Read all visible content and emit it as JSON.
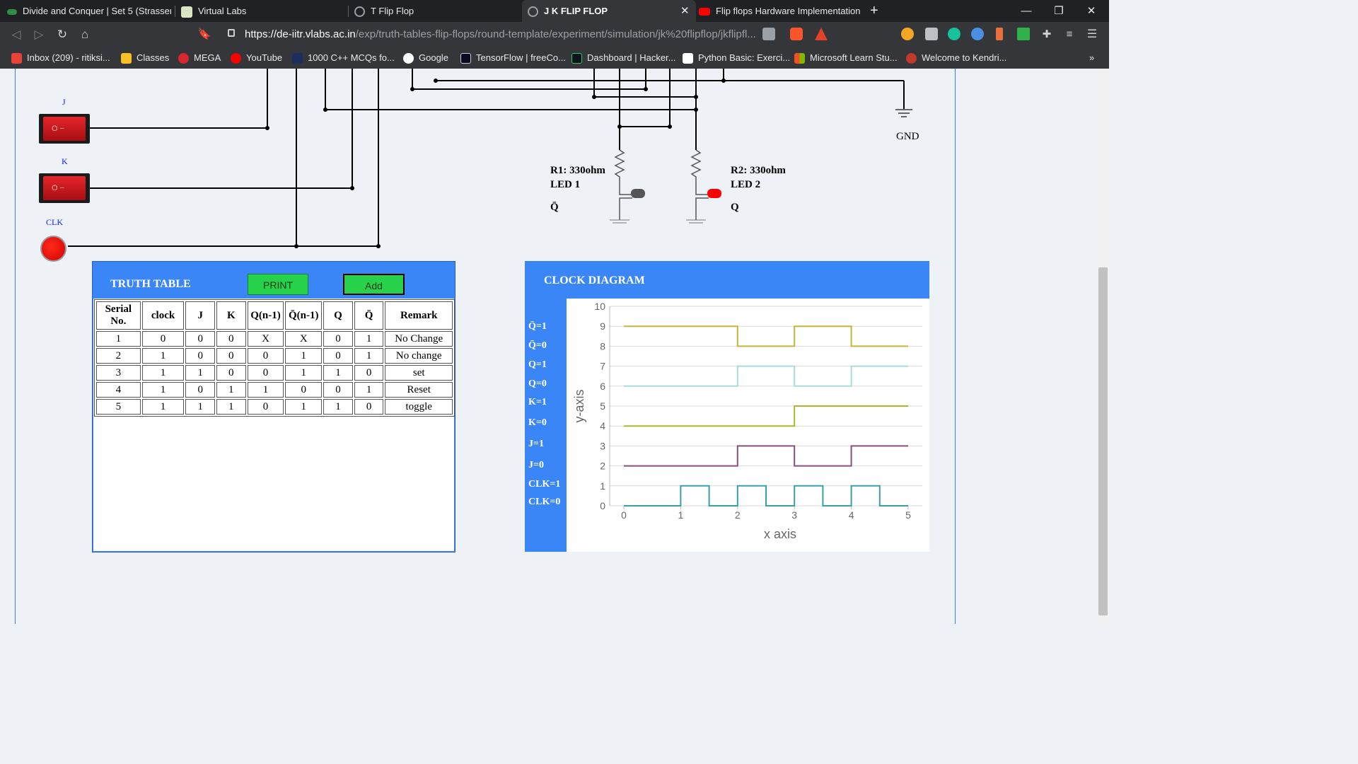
{
  "browser": {
    "tabs": [
      {
        "title": "Divide and Conquer | Set 5 (Strassen's",
        "icon": "gfg-icon",
        "active": false
      },
      {
        "title": "Virtual Labs",
        "icon": "vlabs-icon",
        "active": false
      },
      {
        "title": "T Flip Flop",
        "icon": "globe-icon",
        "active": false
      },
      {
        "title": "J K FLIP FLOP",
        "icon": "globe-icon",
        "active": true
      },
      {
        "title": "Flip flops Hardware Implementation -",
        "icon": "youtube-icon",
        "active": false
      }
    ],
    "url_host": "https://de-iitr.vlabs.ac.in",
    "url_path": "/exp/truth-tables-flip-flops/round-template/experiment/simulation/jk%20flipflop/jkflipfl...",
    "bookmarks": [
      "Inbox (209) - ritiksi...",
      "Classes",
      "MEGA",
      "YouTube",
      "1000 C++ MCQs fo...",
      "Google",
      "TensorFlow | freeCo...",
      "Dashboard | Hacker...",
      "Python Basic: Exerci...",
      "Microsoft Learn Stu...",
      "Welcome to Kendri..."
    ]
  },
  "circuit": {
    "input_j": "J",
    "input_k": "K",
    "input_clk": "CLK",
    "gnd": "GND",
    "r1": "R1: 330ohm",
    "led1": "LED 1",
    "led1_out": "Q̄",
    "r2": "R2: 330ohm",
    "led2": "LED 2",
    "led2_out": "Q"
  },
  "truth_table": {
    "title": "TRUTH TABLE",
    "print_label": "PRINT",
    "add_label": "Add",
    "headers": [
      "Serial No.",
      "clock",
      "J",
      "K",
      "Q(n-1)",
      "Q̄(n-1)",
      "Q",
      "Q̄",
      "Remark"
    ],
    "rows": [
      [
        "1",
        "0",
        "0",
        "0",
        "X",
        "X",
        "0",
        "1",
        "No Change"
      ],
      [
        "2",
        "1",
        "0",
        "0",
        "0",
        "1",
        "0",
        "1",
        "No change"
      ],
      [
        "3",
        "1",
        "1",
        "0",
        "0",
        "1",
        "1",
        "0",
        "set"
      ],
      [
        "4",
        "1",
        "0",
        "1",
        "1",
        "0",
        "0",
        "1",
        "Reset"
      ],
      [
        "5",
        "1",
        "1",
        "1",
        "0",
        "1",
        "1",
        "0",
        "toggle"
      ]
    ]
  },
  "clock_diagram": {
    "title": "CLOCK DIAGRAM",
    "signal_labels": [
      "Q̄=1",
      "Q̄=0",
      "Q=1",
      "Q=0",
      "K=1",
      "K=0",
      "J=1",
      "J=0",
      "CLK=1",
      "CLK=0"
    ]
  },
  "chart_data": {
    "type": "line",
    "xlabel": "x axis",
    "ylabel": "y-axis",
    "xlim": [
      0,
      5
    ],
    "ylim": [
      0,
      10
    ],
    "xticks": [
      0,
      1,
      2,
      3,
      4,
      5
    ],
    "yticks": [
      0,
      1,
      2,
      3,
      4,
      5,
      6,
      7,
      8,
      9,
      10
    ],
    "grid": true,
    "series": [
      {
        "color": "#c8b43a",
        "x": [
          0,
          2,
          2,
          3,
          3,
          4,
          4,
          5
        ],
        "y": [
          9,
          9,
          8,
          8,
          9,
          9,
          8,
          8
        ]
      },
      {
        "color": "#a8dcdc",
        "x": [
          0,
          2,
          2,
          3,
          3,
          4,
          4,
          5
        ],
        "y": [
          6,
          6,
          7,
          7,
          6,
          6,
          7,
          7
        ]
      },
      {
        "color": "#a8b82a",
        "x": [
          0,
          3,
          3,
          5
        ],
        "y": [
          4,
          4,
          5,
          5
        ]
      },
      {
        "color": "#8a4f7a",
        "x": [
          0,
          2,
          2,
          3,
          3,
          4,
          4,
          5
        ],
        "y": [
          2,
          2,
          3,
          3,
          2,
          2,
          3,
          3
        ]
      },
      {
        "color": "#3aa0a8",
        "x": [
          0,
          1,
          1,
          1.5,
          1.5,
          2,
          2,
          2.5,
          2.5,
          3,
          3,
          3.5,
          3.5,
          4,
          4,
          4.5,
          4.5,
          5
        ],
        "y": [
          0,
          0,
          1,
          1,
          0,
          0,
          1,
          1,
          0,
          0,
          1,
          1,
          0,
          0,
          1,
          1,
          0,
          0
        ]
      }
    ]
  }
}
